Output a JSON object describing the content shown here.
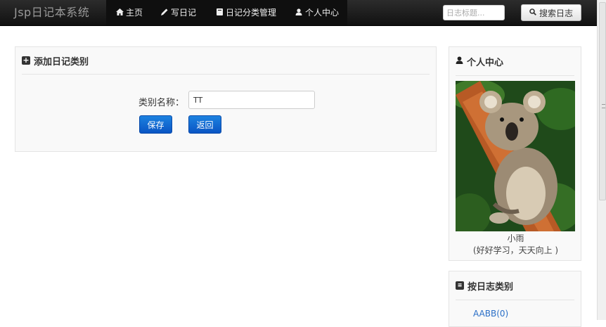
{
  "navbar": {
    "brand": "Jsp日记本系统",
    "items": [
      {
        "label": "主页",
        "icon": "home-icon"
      },
      {
        "label": "写日记",
        "icon": "pencil-icon"
      },
      {
        "label": "日记分类管理",
        "icon": "book-icon"
      },
      {
        "label": "个人中心",
        "icon": "user-icon"
      }
    ],
    "search_placeholder": "日志标题...",
    "search_button": "搜索日志"
  },
  "main": {
    "title": "添加日记类别",
    "form": {
      "label": "类别名称：",
      "value": "TT"
    },
    "save_button": "保存",
    "back_button": "返回"
  },
  "sidebar": {
    "profile": {
      "title": "个人中心",
      "nickname": "小雨",
      "mood": "(好好学习，天天向上 )"
    },
    "categories": {
      "title": "按日志类别",
      "items": [
        {
          "label": "AABB(0)"
        }
      ]
    }
  },
  "colors": {
    "navbar_bg": "#1b1b1b",
    "primary_button": "#0a5fd1",
    "link": "#2a6fc7"
  }
}
